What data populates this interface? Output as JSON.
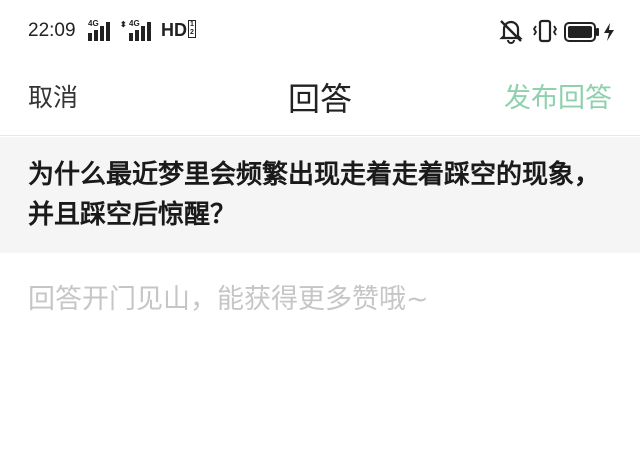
{
  "status_bar": {
    "time": "22:09",
    "network_1": "4G",
    "network_2": "4G",
    "hd": "HD",
    "hd_sub": "1 2",
    "battery_level": 0.8
  },
  "nav": {
    "cancel": "取消",
    "title": "回答",
    "publish": "发布回答",
    "publish_color": "#8ed1ad"
  },
  "question": {
    "text": "为什么最近梦里会频繁出现走着走着踩空的现象，并且踩空后惊醒？"
  },
  "answer": {
    "placeholder": "回答开门见山，能获得更多赞哦~",
    "value": ""
  }
}
